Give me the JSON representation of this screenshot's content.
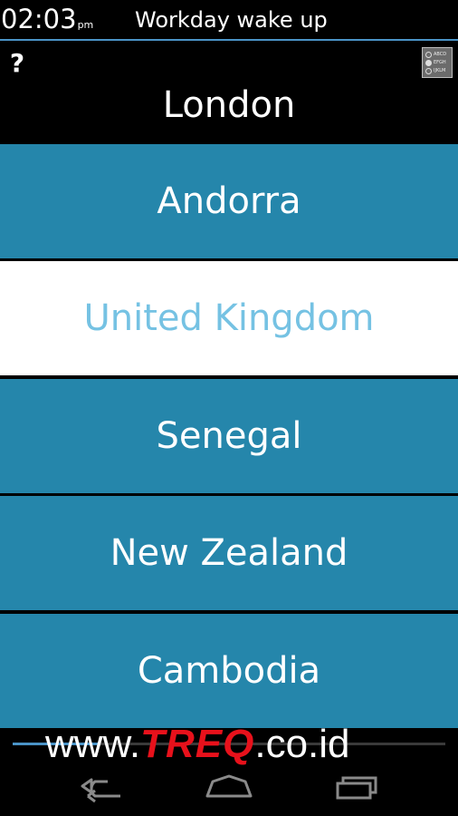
{
  "status": {
    "time": "02:03",
    "ampm": "pm",
    "alarm_label": "Workday wake up"
  },
  "quiz": {
    "help_label": "?",
    "mode_options": [
      "ABCD",
      "EFGH",
      "IJKLM"
    ],
    "question": "London",
    "answers": [
      {
        "label": "Andorra",
        "selected": false
      },
      {
        "label": "United Kingdom",
        "selected": true
      },
      {
        "label": "Senegal",
        "selected": false
      },
      {
        "label": "New Zealand",
        "selected": false
      },
      {
        "label": "Cambodia",
        "selected": false
      }
    ],
    "progress_fraction": 0.2
  },
  "watermark": {
    "prefix": "www.",
    "brand": "TREQ",
    "suffix": ".co.id"
  },
  "navbar": {
    "icons": [
      "back-icon",
      "home-icon",
      "recent-apps-icon"
    ]
  },
  "colors": {
    "answer_bg": "#2586ab",
    "selected_bg": "#ffffff",
    "selected_text": "#75c2e3",
    "accent_line": "#4a93c6",
    "brand_red": "#e8111b"
  }
}
